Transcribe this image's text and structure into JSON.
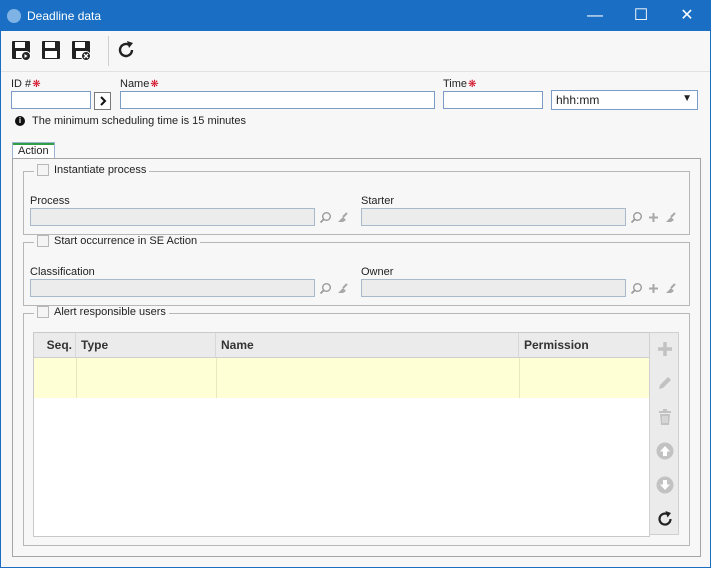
{
  "window": {
    "title": "Deadline data",
    "controls": {
      "minimize": "—",
      "maximize": "☐",
      "close": "✕"
    }
  },
  "toolbar": {
    "buttons": [
      "save-icon",
      "save-and-new-icon",
      "save-and-close-icon",
      "refresh-icon"
    ]
  },
  "form": {
    "id_label": "ID #",
    "name_label": "Name",
    "time_label": "Time",
    "id_value": "",
    "name_value": "",
    "time_value": "",
    "time_unit": "hhh:mm",
    "required_mark": "❋",
    "info_text": "The minimum scheduling time is 15 minutes"
  },
  "tabs": {
    "action": "Action"
  },
  "instantiate": {
    "legend": "Instantiate process",
    "process_label": "Process",
    "starter_label": "Starter"
  },
  "occurrence": {
    "legend": "Start occurrence in SE Action",
    "classification_label": "Classification",
    "owner_label": "Owner"
  },
  "alert": {
    "legend": "Alert responsible users",
    "columns": [
      "Seq.",
      "Type",
      "Name",
      "Permission"
    ],
    "rows": [
      [
        "",
        "",
        "",
        ""
      ]
    ]
  },
  "colors": {
    "titlebar": "#1a6fc4",
    "accent_green": "#2f9e44",
    "row_highlight": "#ffffd5",
    "required": "#d0021b"
  }
}
